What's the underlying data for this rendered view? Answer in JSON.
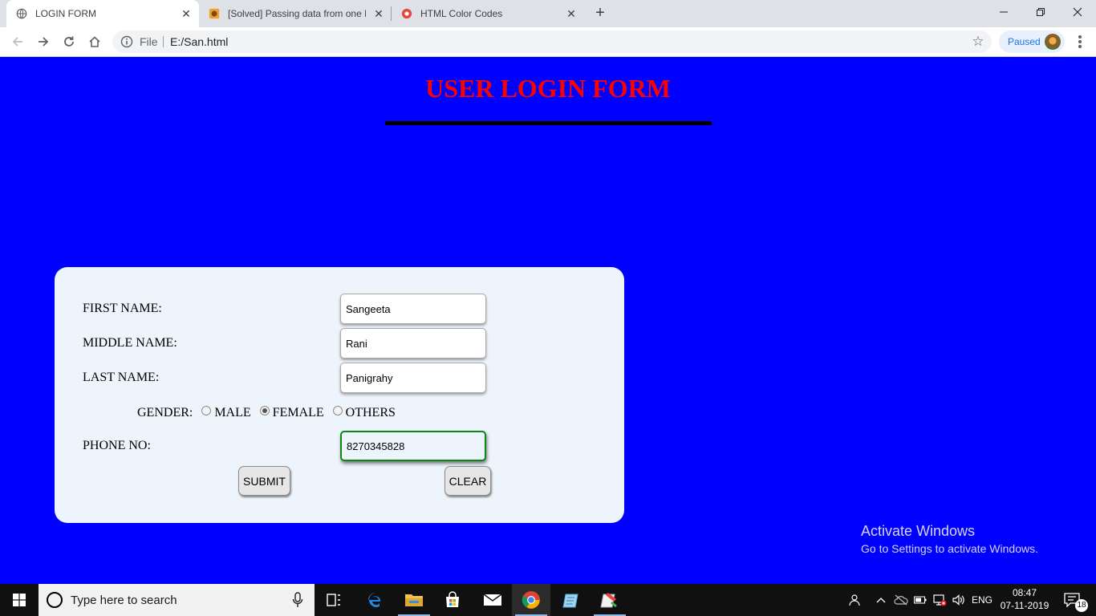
{
  "browser": {
    "tabs": [
      {
        "title": "LOGIN FORM",
        "icon": "globe-icon",
        "active": true
      },
      {
        "title": "[Solved] Passing data from one H",
        "icon": "site-favicon-icon",
        "active": false
      },
      {
        "title": "HTML Color Codes",
        "icon": "color-codes-favicon-icon",
        "active": false
      }
    ],
    "address": {
      "scheme_label": "File",
      "url": "E:/San.html"
    },
    "profile_label": "Paused"
  },
  "page": {
    "title": "USER LOGIN FORM",
    "colors": {
      "background": "#0000ff",
      "title": "#ff0000",
      "card": "#eef4fb",
      "focus_border": "#0a8a12"
    },
    "form": {
      "first_name_label": "FIRST NAME:",
      "first_name_value": "Sangeeta",
      "middle_name_label": "MIDDLE NAME:",
      "middle_name_value": "Rani",
      "last_name_label": "LAST NAME:",
      "last_name_value": "Panigrahy",
      "gender_label": "GENDER:",
      "gender_options": [
        "MALE",
        "FEMALE",
        "OTHERS"
      ],
      "gender_selected": "FEMALE",
      "phone_label": "PHONE NO:",
      "phone_value": "8270345828",
      "submit_label": "SUBMIT",
      "clear_label": "CLEAR"
    }
  },
  "watermark": {
    "line1": "Activate Windows",
    "line2": "Go to Settings to activate Windows."
  },
  "taskbar": {
    "search_placeholder": "Type here to search",
    "apps": [
      "task-view-icon",
      "edge-icon",
      "file-explorer-icon",
      "store-icon",
      "mail-icon",
      "chrome-icon",
      "notepad-icon",
      "paint-app-icon"
    ],
    "language": "ENG",
    "time": "08:47",
    "date": "07-11-2019",
    "notification_count": "18"
  }
}
